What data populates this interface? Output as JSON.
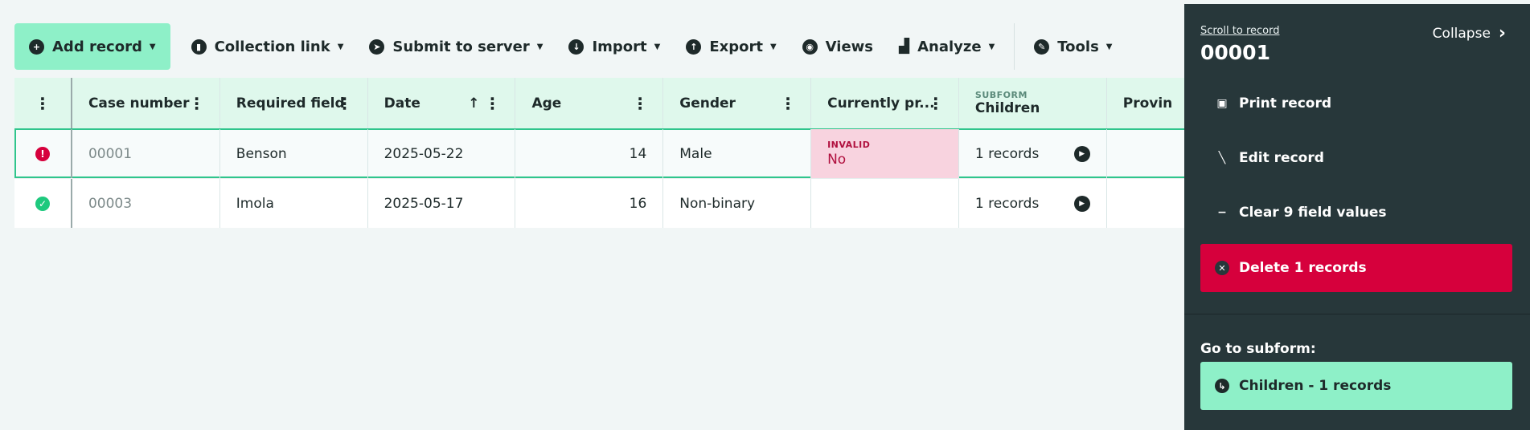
{
  "toolbar": {
    "add_record": "Add record",
    "collection_link": "Collection link",
    "submit_to_server": "Submit to server",
    "import": "Import",
    "export": "Export",
    "views": "Views",
    "analyze": "Analyze",
    "tools": "Tools"
  },
  "table": {
    "headers": {
      "case_number": "Case number",
      "required_field": "Required field",
      "date": "Date",
      "age": "Age",
      "gender": "Gender",
      "currently": "Currently pr...",
      "subform_tag": "SUBFORM",
      "children": "Children",
      "province": "Provin"
    },
    "rows": [
      {
        "case": "00001",
        "required": "Benson",
        "date": "2025-05-22",
        "age": "14",
        "gender": "Male",
        "invalid_label": "INVALID",
        "currently": "No",
        "children": "1 records"
      },
      {
        "case": "00003",
        "required": "Imola",
        "date": "2025-05-17",
        "age": "16",
        "gender": "Non-binary",
        "currently": "",
        "children": "1 records"
      }
    ]
  },
  "panel": {
    "scroll_to_record": "Scroll to record",
    "record_id": "00001",
    "collapse": "Collapse",
    "print_record": "Print record",
    "edit_record": "Edit record",
    "clear_values": "Clear 9 field values",
    "delete_records": "Delete 1 records",
    "go_to_subform": "Go to subform:",
    "subform_link": "Children - 1 records"
  },
  "colors": {
    "accent": "#8ef0c8",
    "danger": "#d6003c",
    "panel_bg": "#27373a",
    "ok": "#1ec97e"
  }
}
